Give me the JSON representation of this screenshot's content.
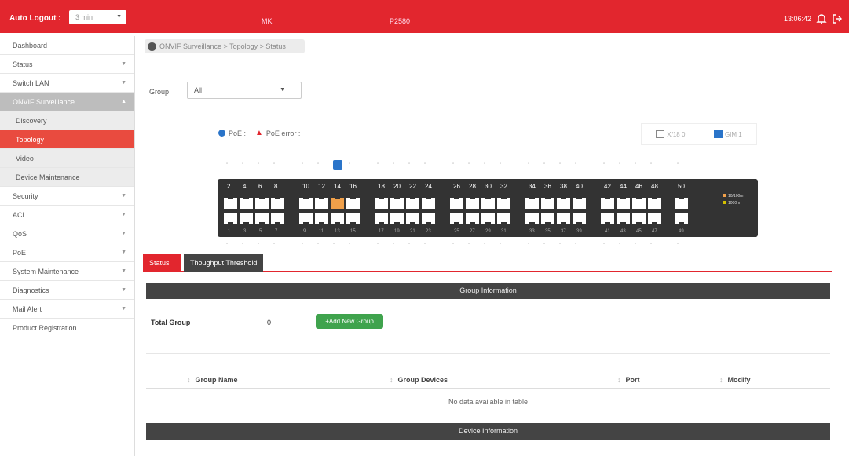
{
  "topbar": {
    "logout_label": "Auto Logout :",
    "logout_value": "3 min",
    "model_text": "MK",
    "device_text": "P2580",
    "time": "13:06:42"
  },
  "sidebar": {
    "items": [
      {
        "label": "Dashboard",
        "arrow": false
      },
      {
        "label": "Status",
        "arrow": true
      },
      {
        "label": "Switch LAN",
        "arrow": true
      },
      {
        "label": "ONVIF Surveillance",
        "arrow": true
      },
      {
        "label": "Discovery",
        "arrow": false
      },
      {
        "label": "Topology",
        "arrow": false
      },
      {
        "label": "Video",
        "arrow": false
      },
      {
        "label": "Device Maintenance",
        "arrow": false
      },
      {
        "label": "Security",
        "arrow": true
      },
      {
        "label": "ACL",
        "arrow": true
      },
      {
        "label": "QoS",
        "arrow": true
      },
      {
        "label": "PoE",
        "arrow": true
      },
      {
        "label": "System Maintenance",
        "arrow": true
      },
      {
        "label": "Diagnostics",
        "arrow": true
      },
      {
        "label": "Mail Alert",
        "arrow": true
      },
      {
        "label": "Product Registration",
        "arrow": false
      }
    ]
  },
  "breadcrumb": "ONVIF Surveillance > Topology > Status",
  "group_filter": {
    "label": "Group",
    "value": "All"
  },
  "legend": {
    "poe": "PoE : ",
    "poe_error": "PoE error : "
  },
  "view_buttons": {
    "a": "X/18 0",
    "b": "GIM 1"
  },
  "switch": {
    "top_numbers": [
      "2",
      "4",
      "6",
      "8",
      "10",
      "12",
      "14",
      "16",
      "18",
      "20",
      "22",
      "24",
      "26",
      "28",
      "30",
      "32",
      "34",
      "36",
      "38",
      "40",
      "42",
      "44",
      "46",
      "48",
      "50"
    ],
    "bottom_numbers": [
      "1",
      "3",
      "5",
      "7",
      "9",
      "11",
      "13",
      "15",
      "17",
      "19",
      "21",
      "23",
      "25",
      "27",
      "29",
      "31",
      "33",
      "35",
      "37",
      "39",
      "41",
      "43",
      "45",
      "47",
      "49"
    ],
    "legend_a": "10/100m",
    "legend_b": "1000m"
  },
  "tabs": {
    "status": "Status",
    "throughput": "Thoughput Threshold"
  },
  "group_info": {
    "header": "Group Information",
    "total_label": "Total Group",
    "total_value": "0",
    "add_button": "+Add New Group"
  },
  "table": {
    "columns": [
      "Group Name",
      "Group Devices",
      "Port",
      "Modify"
    ],
    "empty": "No data available in table"
  },
  "device_info": {
    "header": "Device Information"
  }
}
